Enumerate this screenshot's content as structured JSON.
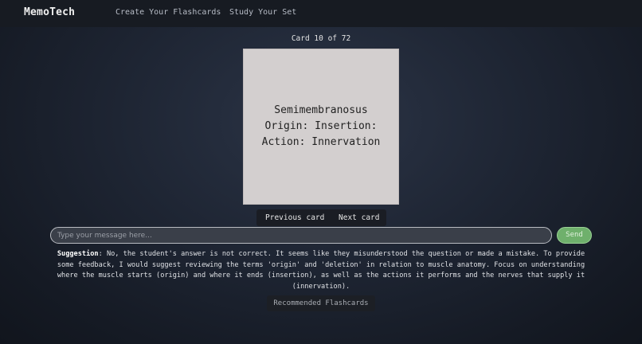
{
  "app": {
    "brand": "MemoTech"
  },
  "nav": {
    "create_label": "Create Your Flashcards",
    "study_label": "Study Your Set"
  },
  "study": {
    "counter": "Card 10 of 72",
    "card": {
      "line1": "Semimembranosus",
      "line2": "Origin: Insertion:",
      "line3": "Action: Innervation"
    },
    "prev_label": "Previous card",
    "next_label": "Next card"
  },
  "chat": {
    "placeholder": "Type your message here...",
    "value": "",
    "send_label": "Send"
  },
  "suggestion": {
    "label": "Suggestion",
    "text": ": No, the student's answer is not correct. It seems like they misunderstood the question or made a mistake. To provide some feedback, I would suggest reviewing the terms 'origin' and 'deletion' in relation to muscle anatomy. Focus on understanding where the muscle starts (origin) and where it ends (insertion), as well as the actions it performs and the nerves that supply it (innervation)."
  },
  "recommended_label": "Recommended Flashcards",
  "colors": {
    "background": "#1e2533",
    "navbar": "#171b22",
    "card": "#d3cfcf",
    "send_button": "#6fb06c"
  }
}
